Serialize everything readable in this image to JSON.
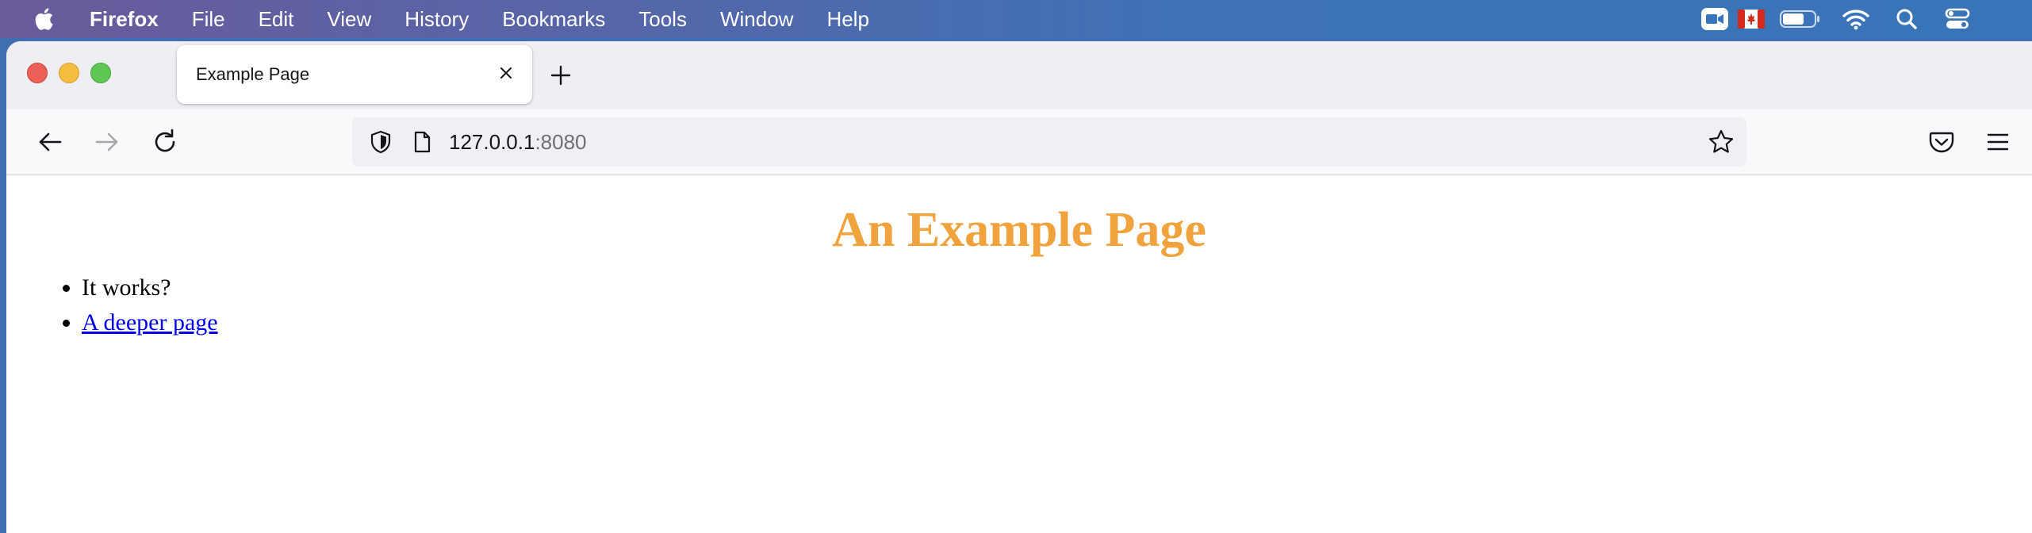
{
  "menubar": {
    "app_name": "Firefox",
    "items": [
      "File",
      "Edit",
      "View",
      "History",
      "Bookmarks",
      "Tools",
      "Window",
      "Help"
    ],
    "status_icons": [
      "video-camera-icon",
      "canada-flag-icon",
      "battery-icon",
      "wifi-icon",
      "spotlight-search-icon",
      "control-center-icon"
    ]
  },
  "browser": {
    "tab": {
      "title": "Example Page"
    },
    "url": {
      "host": "127.0.0.1",
      "port": ":8080"
    }
  },
  "page": {
    "heading": "An Example Page",
    "heading_color": "#f0a23c",
    "list_items": [
      {
        "text": "It works?",
        "link": false
      },
      {
        "text": "A deeper page",
        "link": true
      }
    ],
    "link_color": "#0000ee"
  }
}
